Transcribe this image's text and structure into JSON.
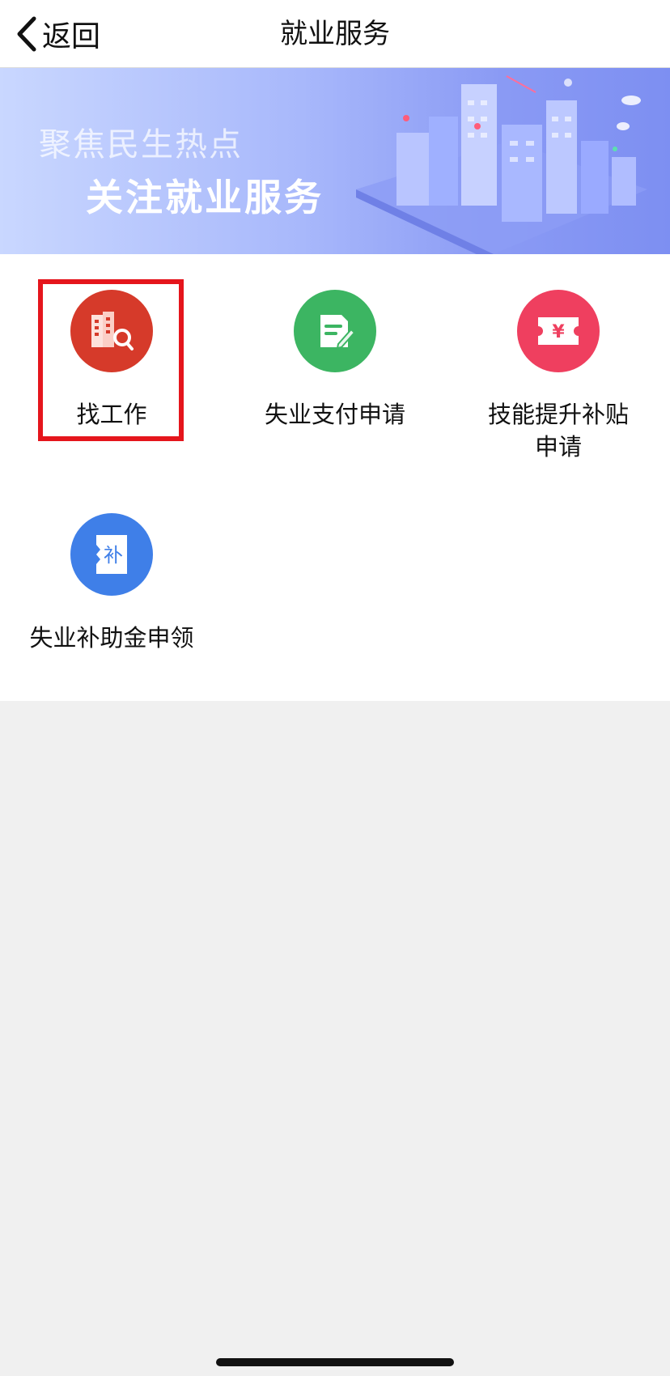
{
  "header": {
    "back_label": "返回",
    "title": "就业服务"
  },
  "banner": {
    "subtitle": "聚焦民生热点",
    "headline": "关注就业服务"
  },
  "services": [
    {
      "label": "找工作",
      "icon": "building-search-icon",
      "color": "#d63a2a",
      "highlighted": true
    },
    {
      "label": "失业支付申请",
      "icon": "document-edit-icon",
      "color": "#3cb562"
    },
    {
      "label_line1": "技能提升补贴",
      "label_line2": "申请",
      "icon": "yen-ticket-icon",
      "color": "#ef3f5f"
    },
    {
      "label": "失业补助金申领",
      "icon": "subsidy-ticket-icon",
      "color": "#3f7fe8",
      "icon_char": "补"
    }
  ],
  "colors": {
    "highlight_border": "#e5151c",
    "page_background": "#f0f0f0"
  }
}
